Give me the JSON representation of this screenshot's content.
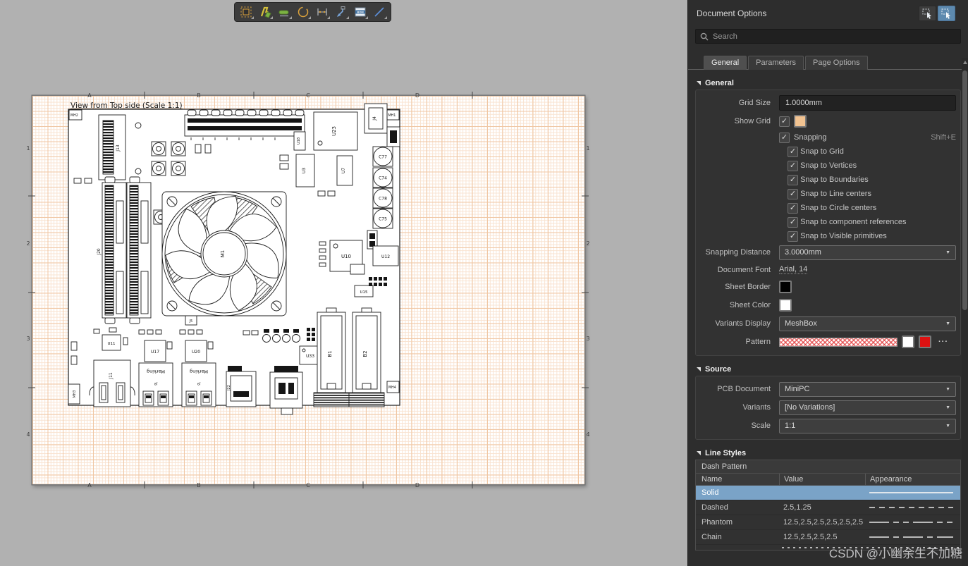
{
  "toolbar": {
    "icons": [
      {
        "name": "place-board-assembly-view"
      },
      {
        "name": "place-board-fabrication-view"
      },
      {
        "name": "place-section-view"
      },
      {
        "name": "place-detail-view"
      },
      {
        "name": "place-dimension"
      },
      {
        "name": "place-callout"
      },
      {
        "name": "place-bill-of-materials"
      },
      {
        "name": "place-line"
      }
    ]
  },
  "panel": {
    "title": "Document Options",
    "search_placeholder": "Search",
    "tabs": [
      {
        "label": "General"
      },
      {
        "label": "Parameters"
      },
      {
        "label": "Page Options"
      }
    ],
    "general": {
      "section_label": "General",
      "grid_size_label": "Grid Size",
      "grid_size_value": "1.0000mm",
      "show_grid_label": "Show Grid",
      "show_grid_color": "#f2c391",
      "snapping_label": "Snapping",
      "snapping_shortcut": "Shift+E",
      "snap_options": [
        "Snap to Grid",
        "Snap to Vertices",
        "Snap to Boundaries",
        "Snap to Line centers",
        "Snap to Circle centers",
        "Snap to component references",
        "Snap to Visible primitives"
      ],
      "snapping_distance_label": "Snapping Distance",
      "snapping_distance_value": "3.0000mm",
      "document_font_label": "Document Font",
      "document_font_value": "Arial, 14",
      "sheet_border_label": "Sheet Border",
      "sheet_border_color": "#000000",
      "sheet_color_label": "Sheet Color",
      "sheet_color_value": "#ffffff",
      "variants_display_label": "Variants Display",
      "variants_display_value": "MeshBox",
      "pattern_label": "Pattern",
      "pattern_swatch_colors": [
        "#ffffff",
        "#dd1111"
      ],
      "pattern_more": "···"
    },
    "source": {
      "section_label": "Source",
      "pcb_document_label": "PCB Document",
      "pcb_document_value": "MiniPC",
      "variants_label": "Variants",
      "variants_value": "[No Variations]",
      "scale_label": "Scale",
      "scale_value": "1:1"
    },
    "line_styles": {
      "section_label": "Line Styles",
      "table_title": "Dash Pattern",
      "columns": [
        "Name",
        "Value",
        "Appearance"
      ],
      "rows": [
        {
          "name": "Solid",
          "value": "",
          "dash": "solid",
          "selected": true
        },
        {
          "name": "Dashed",
          "value": "2.5,1.25",
          "dash": "dashed",
          "selected": false
        },
        {
          "name": "Phantom",
          "value": "12.5,2.5,2.5,2.5,2.5,2.5",
          "dash": "phantom",
          "selected": false
        },
        {
          "name": "Chain",
          "value": "12.5,2.5,2.5,2.5",
          "dash": "chain",
          "selected": false
        }
      ]
    }
  },
  "sheet": {
    "title": "View from Top side (Scale 1:1)",
    "zone_cols": [
      "A",
      "B",
      "C",
      "D"
    ],
    "zone_rows": [
      "1",
      "2",
      "3",
      "4"
    ]
  },
  "board": {
    "labels": {
      "mh1": "MH1",
      "mh2": "MH2",
      "mh3": "MH3",
      "mh4": "MH4",
      "j4": "J4",
      "j5": "J5",
      "j8": "J8",
      "j9": "J9",
      "j11": "J11",
      "j13": "J13",
      "j20": "J20",
      "j22": "J22",
      "u3": "U3",
      "u7": "U7",
      "u18": "U18",
      "u23": "U23",
      "u10": "U10",
      "u11": "U11",
      "u12": "U12",
      "u15": "U15",
      "u17": "U17",
      "u20": "U20",
      "u33": "U33",
      "c77": "C77",
      "c74": "C74",
      "c78": "C78",
      "c75": "C75",
      "b1": "B1",
      "b2": "B2",
      "m1": "M1",
      "marking": "Marking"
    }
  },
  "watermark": "CSDN @小幽余生不加糖"
}
